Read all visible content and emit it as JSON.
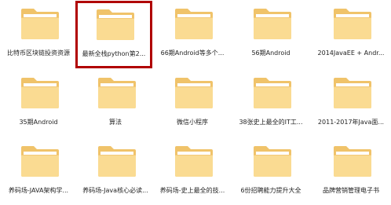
{
  "folders": [
    {
      "label": "比特币区块链投资资源",
      "selected": false
    },
    {
      "label": "最新全栈python第2...",
      "selected": true
    },
    {
      "label": "66期Android等多个...",
      "selected": false
    },
    {
      "label": "56期Android",
      "selected": false
    },
    {
      "label": "2014JavaEE + Andr...",
      "selected": false
    },
    {
      "label": "35期Android",
      "selected": false
    },
    {
      "label": "算法",
      "selected": false
    },
    {
      "label": "微信小程序",
      "selected": false
    },
    {
      "label": "38张史上最全的IT工...",
      "selected": false
    },
    {
      "label": "2011-2017年Java面...",
      "selected": false
    },
    {
      "label": "养码场-JAVA架构学...",
      "selected": false
    },
    {
      "label": "养码场-Java核心必读...",
      "selected": false
    },
    {
      "label": "养码场-史上最全的技...",
      "selected": false
    },
    {
      "label": "6份招聘能力提升大全",
      "selected": false
    },
    {
      "label": "品牌营销管理电子书",
      "selected": false
    }
  ],
  "colors": {
    "folder_back": "#f0c36a",
    "folder_front": "#fadb92",
    "folder_paper": "#ffffff",
    "selection_border": "#b00000"
  },
  "icon": "folder-icon"
}
